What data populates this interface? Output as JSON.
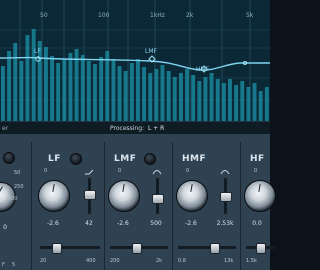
{
  "display": {
    "freq_labels": [
      "50",
      "100",
      "1kHz",
      "2k",
      "5k"
    ],
    "band_nodes": [
      {
        "label": "LF"
      },
      {
        "label": "LMF"
      },
      {
        "label": "HMF"
      }
    ],
    "footer_left": "er",
    "processing_label": "Processing:",
    "processing_value": "L + R"
  },
  "left_strip": {
    "scale": [
      "50",
      "250",
      "500"
    ],
    "bottom_scale": [
      "F",
      "5"
    ],
    "value_tail": "0"
  },
  "bands": [
    {
      "name": "LF",
      "gain_scale": "0",
      "freq_value": "-2.6",
      "fader_value": "42",
      "bottom_scale": [
        "20",
        "400"
      ]
    },
    {
      "name": "LMF",
      "gain_scale": "0",
      "freq_value": "-2.6",
      "fader_value": "500",
      "bottom_scale": [
        "200",
        "2k"
      ]
    },
    {
      "name": "HMF",
      "gain_scale": "0",
      "freq_value": "-2.6",
      "fader_value": "2.53k",
      "bottom_scale": [
        "0.8",
        "13k"
      ]
    },
    {
      "name": "HF",
      "gain_scale": "0",
      "freq_value": "0.0",
      "fader_value": "",
      "bottom_scale": [
        "1.5k",
        ""
      ]
    }
  ],
  "colors": {
    "curve": "#7fd3ee",
    "spectrum": "#1b93a8",
    "panel": "#2f4252",
    "screen": "#0b2836"
  },
  "icons": [
    "lowshelf-icon",
    "bell-icon",
    "highshelf-icon"
  ]
}
